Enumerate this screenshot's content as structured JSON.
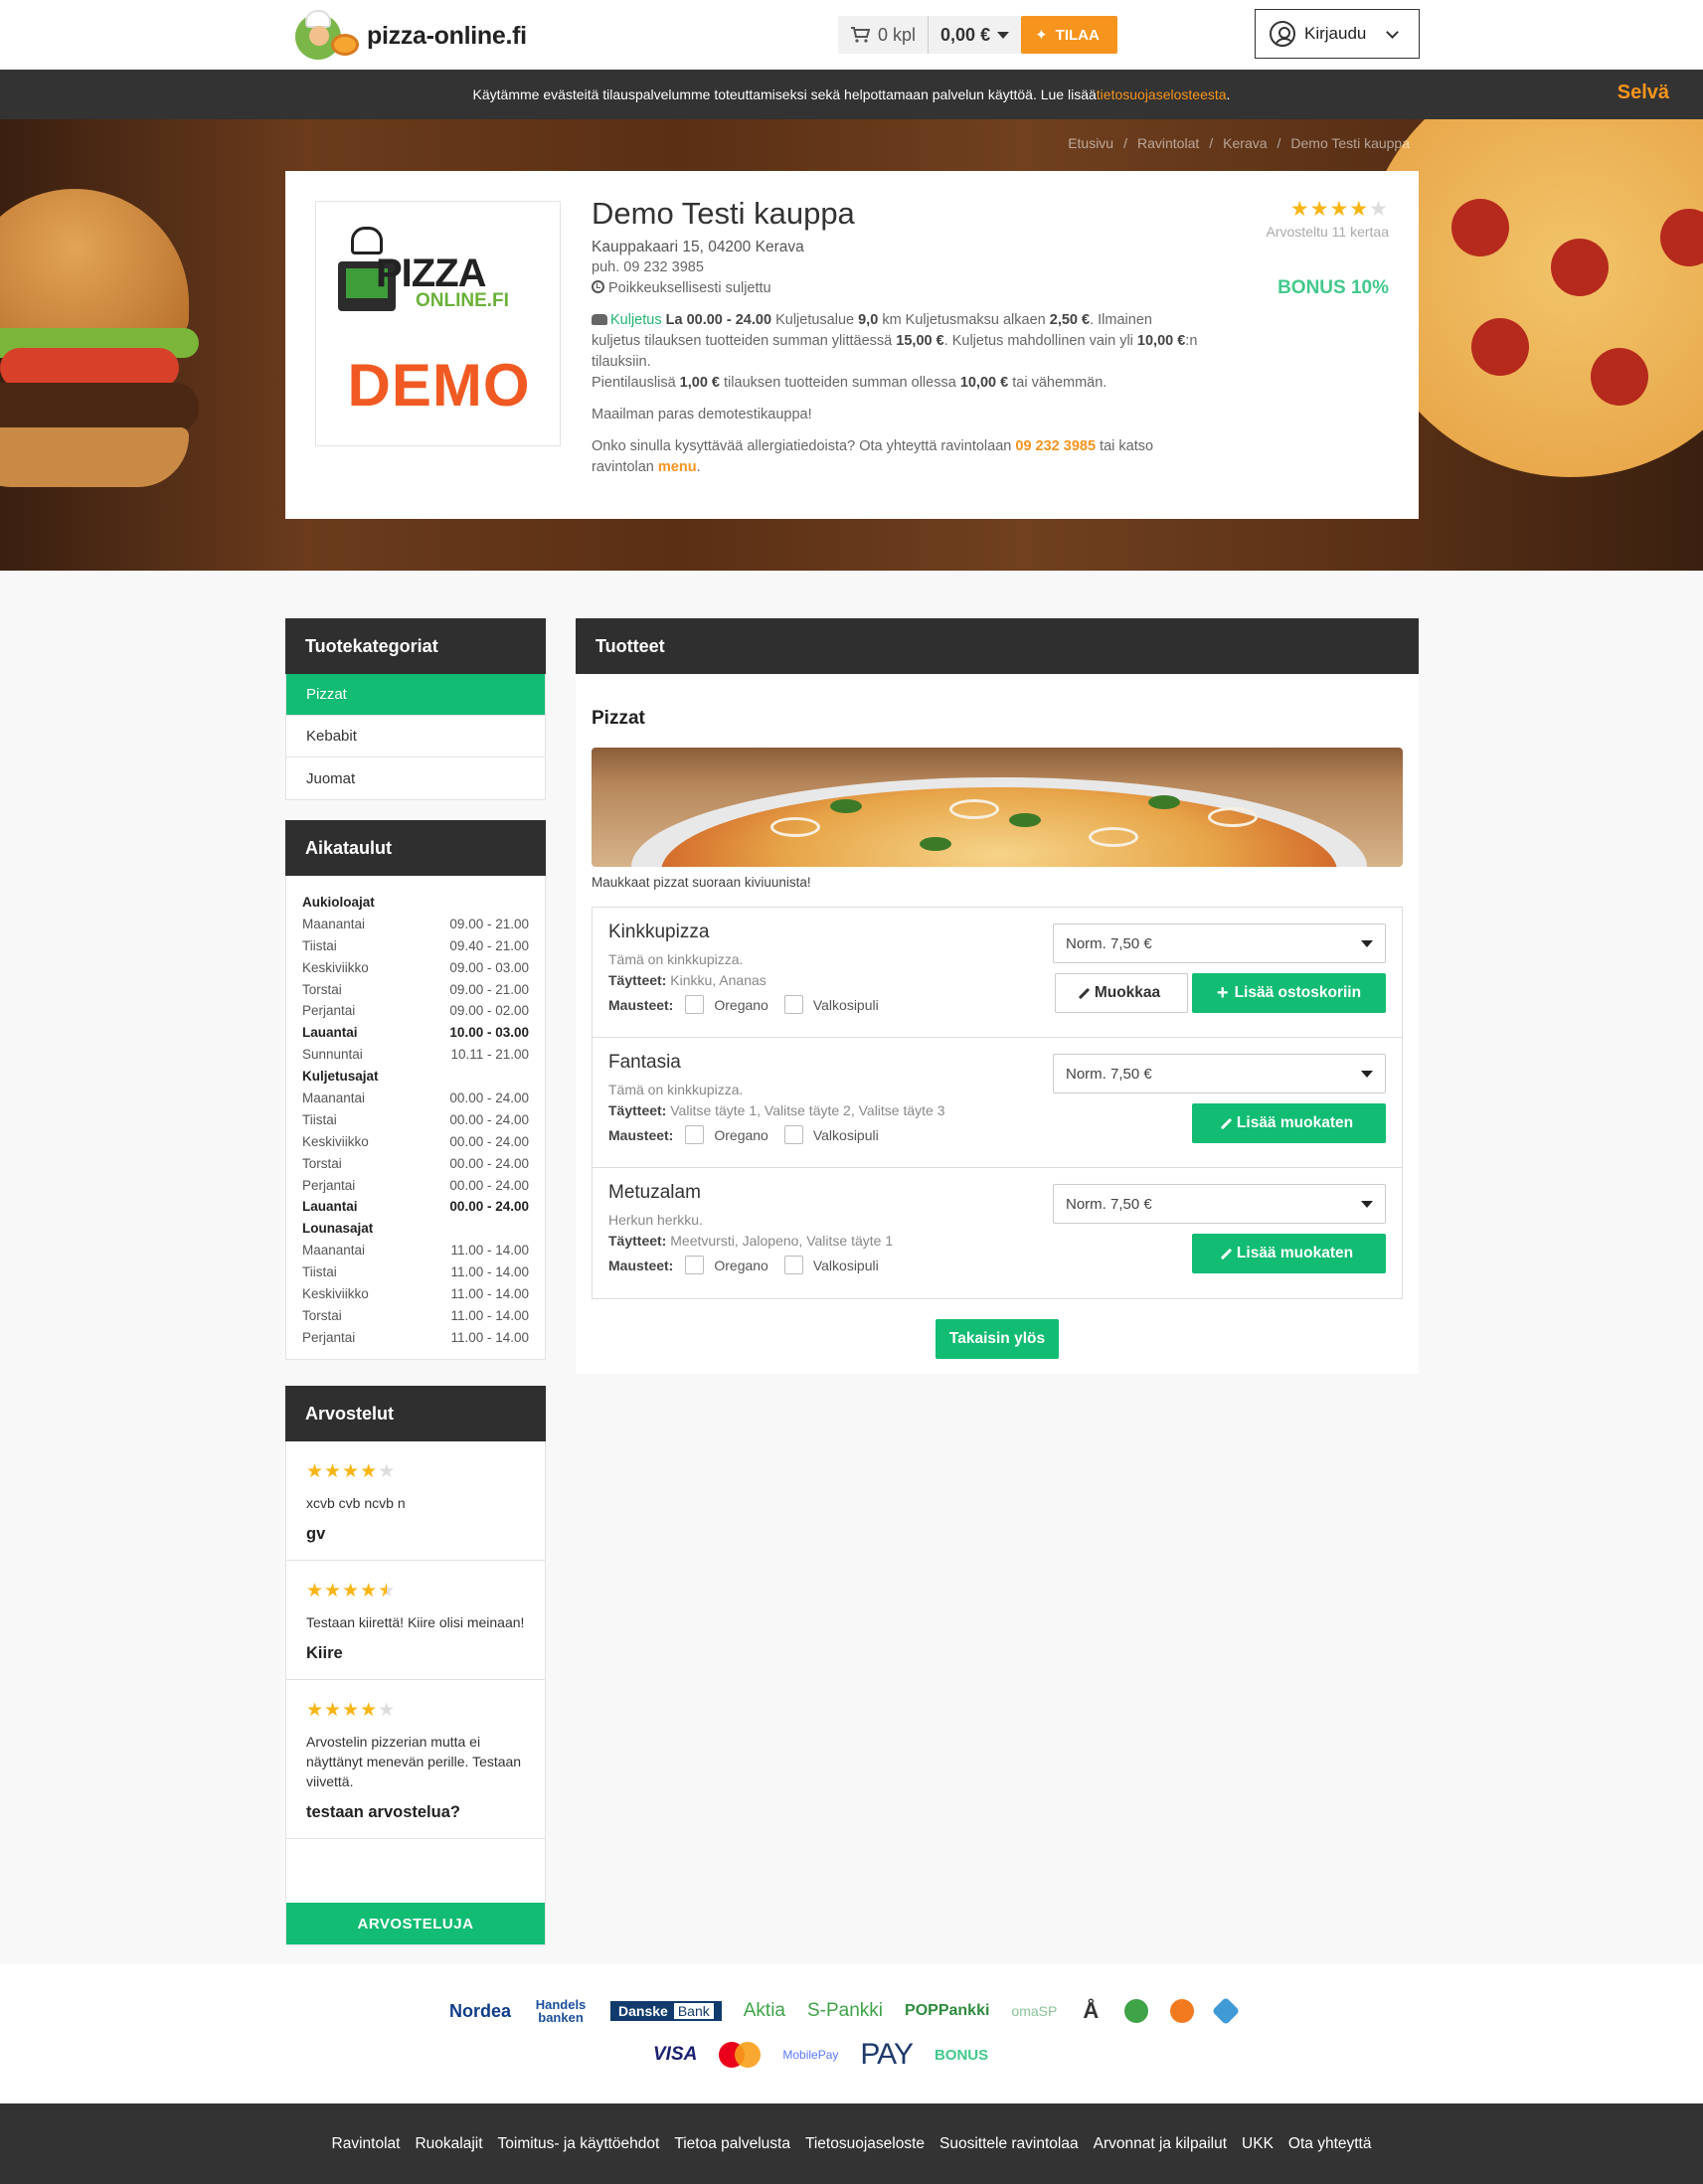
{
  "header": {
    "site_name": "pizza-online.fi",
    "cart_count": "0 kpl",
    "cart_total": "0,00 €",
    "order_label": "TILAA",
    "login_label": "Kirjaudu"
  },
  "cookie": {
    "text": "Käytämme evästeitä tilauspalvelumme toteuttamiseksi sekä helpottamaan palvelun käyttöä. Lue lisää ",
    "link": "tietosuojaselosteesta",
    "end": ".",
    "ok": "Selvä"
  },
  "breadcrumb": [
    "Etusivu",
    "Ravintolat",
    "Kerava",
    "Demo Testi kauppa"
  ],
  "restaurant": {
    "logo_text_1": "PIZZA",
    "logo_text_2": "ONLINE.FI",
    "logo_demo": "DEMO",
    "name": "Demo Testi kauppa",
    "address": "Kauppakaari 15, 04200 Kerava",
    "phone": "puh. 09 232 3985",
    "status": "Poikkeuksellisesti suljettu",
    "delivery_label": "Kuljetus",
    "delivery_hours": "La 00.00 - 24.00",
    "delivery_area_label": "Kuljetusalue",
    "delivery_area": "9,0",
    "delivery_fee_label": "km Kuljetusmaksu alkaen",
    "delivery_fee": "2,50 €",
    "free_delivery_text": ". Ilmainen kuljetus tilauksen tuotteiden summan ylittäessä",
    "free_delivery_limit": "15,00 €",
    "min_order_text": ". Kuljetus mahdollinen vain yli",
    "min_order": "10,00 €",
    "min_order_end": ":n tilauksiin.",
    "small_fee_label": "Pientilauslisä",
    "small_fee": "1,00 €",
    "small_fee_text": "tilauksen tuotteiden summan ollessa",
    "small_fee_limit": "10,00 €",
    "small_fee_end": "tai vähemmän.",
    "tagline": "Maailman paras demotestikauppa!",
    "allergy_text": "Onko sinulla kysyttävää allergiatiedoista? Ota yhteyttä ravintolaan",
    "allergy_phone": "09 232 3985",
    "allergy_mid": "tai katso ravintolan",
    "allergy_menu": "menu",
    "allergy_end": ".",
    "rating_stars": 4,
    "rating_count": "Arvosteltu 11 kertaa",
    "bonus": "BONUS 10%"
  },
  "categories": {
    "title": "Tuotekategoriat",
    "items": [
      "Pizzat",
      "Kebabit",
      "Juomat"
    ],
    "active_index": 0
  },
  "schedule": {
    "title": "Aikataulut",
    "sections": [
      {
        "name": "Aukioloajat",
        "rows": [
          {
            "day": "Maanantai",
            "time": "09.00 - 21.00"
          },
          {
            "day": "Tiistai",
            "time": "09.40 - 21.00"
          },
          {
            "day": "Keskiviikko",
            "time": "09.00 - 03.00"
          },
          {
            "day": "Torstai",
            "time": "09.00 - 21.00"
          },
          {
            "day": "Perjantai",
            "time": "09.00 - 02.00"
          },
          {
            "day": "Lauantai",
            "time": "10.00 - 03.00",
            "today": true
          },
          {
            "day": "Sunnuntai",
            "time": "10.11 - 21.00"
          }
        ]
      },
      {
        "name": "Kuljetusajat",
        "rows": [
          {
            "day": "Maanantai",
            "time": "00.00 - 24.00"
          },
          {
            "day": "Tiistai",
            "time": "00.00 - 24.00"
          },
          {
            "day": "Keskiviikko",
            "time": "00.00 - 24.00"
          },
          {
            "day": "Torstai",
            "time": "00.00 - 24.00"
          },
          {
            "day": "Perjantai",
            "time": "00.00 - 24.00"
          },
          {
            "day": "Lauantai",
            "time": "00.00 - 24.00",
            "today": true
          }
        ]
      },
      {
        "name": "Lounasajat",
        "rows": [
          {
            "day": "Maanantai",
            "time": "11.00 - 14.00"
          },
          {
            "day": "Tiistai",
            "time": "11.00 - 14.00"
          },
          {
            "day": "Keskiviikko",
            "time": "11.00 - 14.00"
          },
          {
            "day": "Torstai",
            "time": "11.00 - 14.00"
          },
          {
            "day": "Perjantai",
            "time": "11.00 - 14.00"
          }
        ]
      }
    ]
  },
  "reviews": {
    "title": "Arvostelut",
    "items": [
      {
        "stars": 4,
        "text": "xcvb cvb ncvb n",
        "name": "gv"
      },
      {
        "stars": 4.5,
        "text": "Testaan kiirettä! Kiire olisi meinaan!",
        "name": "Kiire"
      },
      {
        "stars": 4,
        "text": "Arvostelin pizzerian mutta ei näyttänyt menevän perille. Testaan viivettä.",
        "name": "testaan arvostelua?"
      }
    ],
    "button": "ARVOSTELUJA"
  },
  "products": {
    "title": "Tuotteet",
    "category": "Pizzat",
    "category_desc": "Maukkaat pizzat suoraan kiviuunista!",
    "toppings_label": "Täytteet:",
    "spices_label": "Mausteet:",
    "spices": [
      "Oregano",
      "Valkosipuli"
    ],
    "items": [
      {
        "name": "Kinkkupizza",
        "desc": "Tämä on kinkkupizza.",
        "toppings": "Kinkku, Ananas",
        "size": "Norm. 7,50 €",
        "edit": "Muokkaa",
        "add": "Lisää ostoskoriin"
      },
      {
        "name": "Fantasia",
        "desc": "Tämä on kinkkupizza.",
        "toppings": "Valitse täyte 1, Valitse täyte 2, Valitse täyte 3",
        "size": "Norm. 7,50 €",
        "add": "Lisää muokaten"
      },
      {
        "name": "Metuzalam",
        "desc": "Herkun herkku.",
        "toppings": "Meetvursti, Jalopeno, Valitse täyte 1",
        "size": "Norm. 7,50 €",
        "add": "Lisää muokaten"
      }
    ],
    "back_top": "Takaisin ylös"
  },
  "payments": {
    "row1": [
      "Nordea",
      "Handels banken",
      "Danske",
      "Bank",
      "Aktia",
      "S-Pankki",
      "POPPankki",
      "omaSP"
    ],
    "row2": [
      "VISA",
      "MobilePay",
      "PAY",
      "BONUS"
    ],
    "colors": {
      "nordea": "#0f3d8a",
      "handels": "#1a4f9c",
      "aktia": "#3fa348",
      "spankki": "#3fa348",
      "pop": "#2f8b3e",
      "omasp": "#8bc29a",
      "visa": "#1a1f71",
      "mobilepay": "#5a78ff",
      "pay": "#1d3a6b",
      "bonus": "#41c98c"
    }
  },
  "footer": {
    "links": [
      "Ravintolat",
      "Ruokalajit",
      "Toimitus- ja käyttöehdot",
      "Tietoa palvelusta",
      "Tietosuojaseloste",
      "Suosittele ravintolaa",
      "Arvonnat ja kilpailut",
      "UKK",
      "Ota yhteyttä"
    ]
  },
  "colors": {
    "accent_green": "#12bc73",
    "accent_orange": "#f7941d",
    "dark": "#2f2f2f"
  }
}
